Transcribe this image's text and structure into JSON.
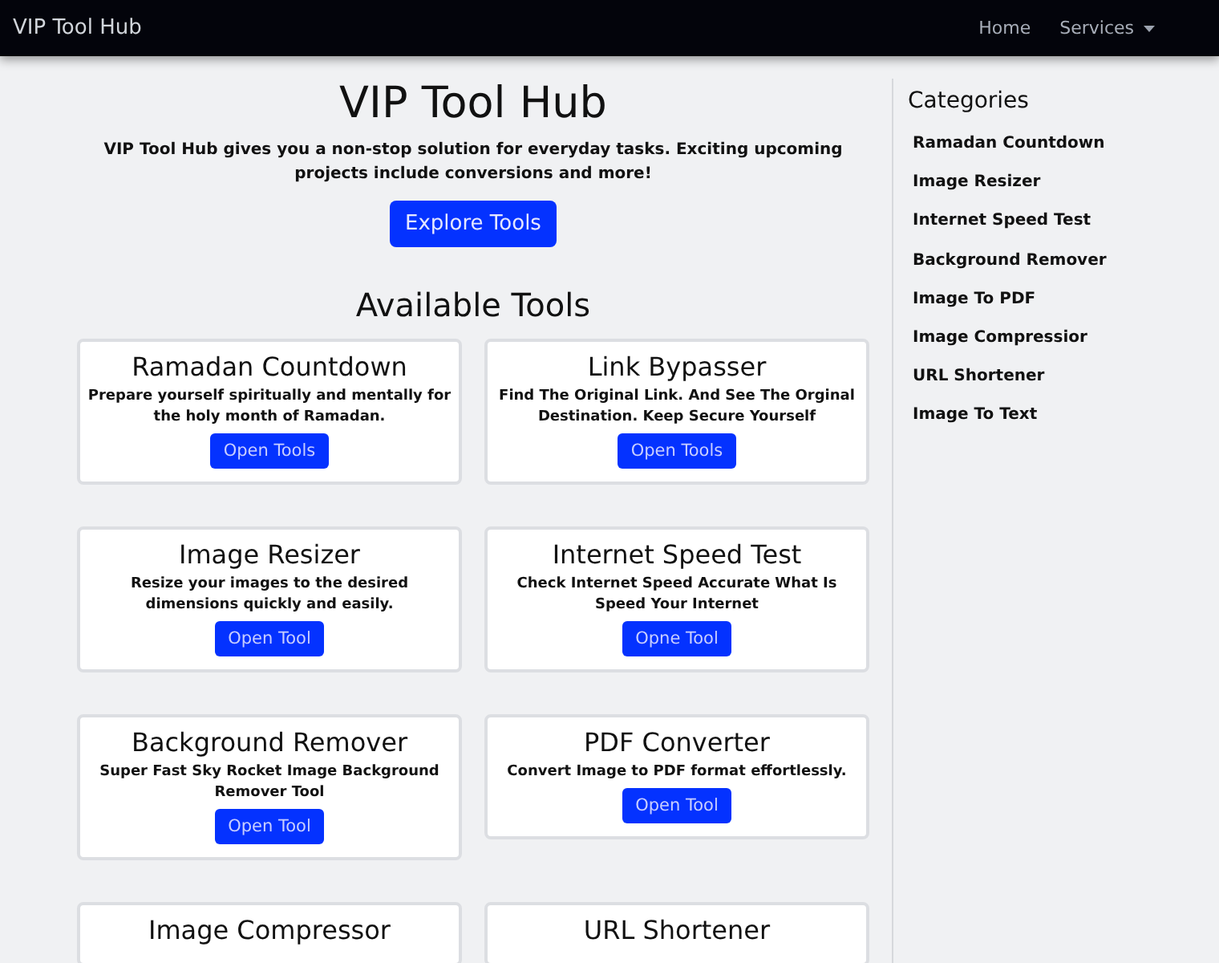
{
  "navbar": {
    "brand": "VIP Tool Hub",
    "links": [
      {
        "label": "Home",
        "dropdown": false
      },
      {
        "label": "Services",
        "dropdown": true
      }
    ]
  },
  "hero": {
    "title": "VIP Tool Hub",
    "text": "VIP Tool Hub gives you a non-stop solution for everyday tasks. Exciting upcoming projects include conversions and more!",
    "button": "Explore Tools"
  },
  "tools_heading": "Available Tools",
  "tools": [
    {
      "title": "Ramadan Countdown",
      "description": "Prepare yourself spiritually and mentally for the holy month of Ramadan.",
      "button": "Open Tools"
    },
    {
      "title": "Link Bypasser",
      "description": "Find The Original Link. And See The Orginal Destination. Keep Secure Yourself",
      "button": "Open Tools"
    },
    {
      "title": "Image Resizer",
      "description": "Resize your images to the desired dimensions quickly and easily.",
      "button": "Open Tool"
    },
    {
      "title": "Internet Speed Test",
      "description": "Check Internet Speed Accurate What Is Speed Your Internet",
      "button": "Opne Tool"
    },
    {
      "title": "Background Remover",
      "description": "Super Fast Sky Rocket Image Background Remover Tool",
      "button": "Open Tool"
    },
    {
      "title": "PDF Converter",
      "description": "Convert Image to PDF format effortlessly.",
      "button": "Open Tool"
    },
    {
      "title": "Image Compressor"
    },
    {
      "title": "URL Shortener"
    }
  ],
  "sidebar": {
    "title": "Categories",
    "items": [
      "Ramadan Countdown",
      "Image Resizer",
      "Internet Speed Test",
      "Background Remover",
      "Image To PDF",
      "Image Compressior",
      "URL Shortener",
      "Image To Text"
    ]
  }
}
